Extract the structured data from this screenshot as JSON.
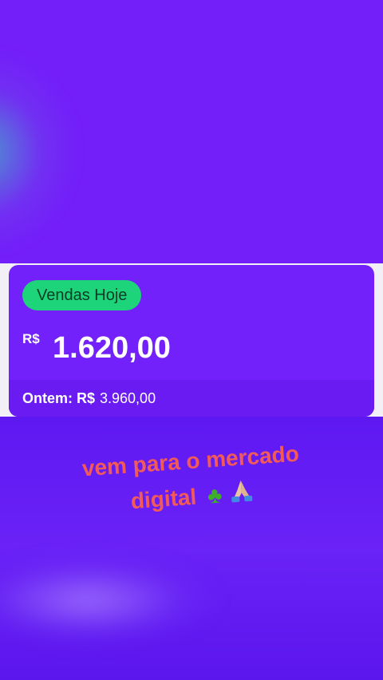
{
  "card": {
    "badge_label": "Vendas Hoje",
    "currency": "R$",
    "amount": "1.620,00",
    "yesterday_label": "Ontem: R$",
    "yesterday_amount": "3.960,00"
  },
  "caption": {
    "line1": "vem para o mercado",
    "line2": "digital"
  },
  "icons": {
    "clover": "four-leaf-clover-icon",
    "pray": "folded-hands-icon"
  },
  "colors": {
    "background": "#731ff9",
    "card": "#7321fb",
    "badge": "#1ed47a",
    "caption": "#f25a5a"
  }
}
